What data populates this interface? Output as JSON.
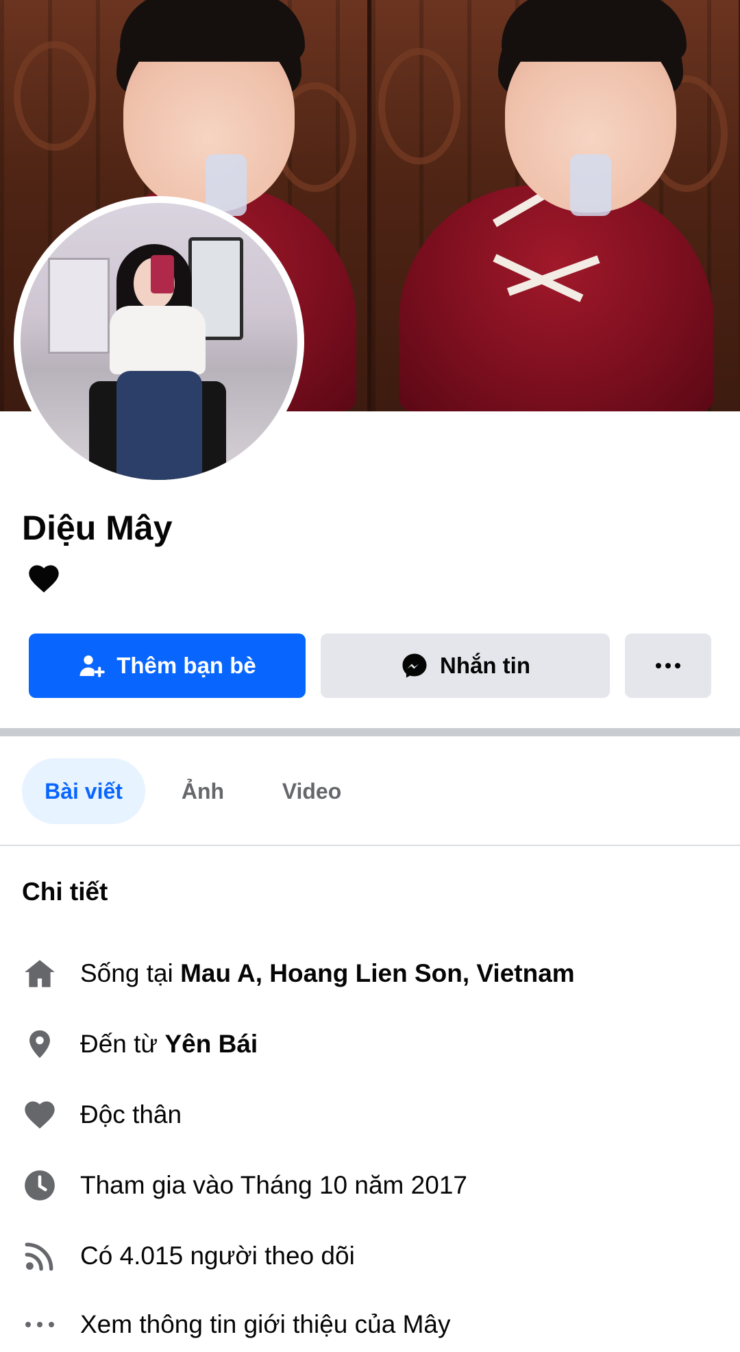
{
  "profile": {
    "name": "Diệu Mây",
    "bio_icon": "black-heart-icon"
  },
  "actions": {
    "add_friend_label": "Thêm bạn bè",
    "message_label": "Nhắn tin",
    "more_label": "···"
  },
  "tabs": [
    {
      "label": "Bài viết",
      "active": true
    },
    {
      "label": "Ảnh",
      "active": false
    },
    {
      "label": "Video",
      "active": false
    }
  ],
  "details": {
    "title": "Chi tiết",
    "items": [
      {
        "icon": "home-icon",
        "prefix": "Sống tại ",
        "bold": "Mau A, Hoang Lien Son, Vietnam"
      },
      {
        "icon": "location-pin-icon",
        "prefix": "Đến từ ",
        "bold": "Yên Bái"
      },
      {
        "icon": "heart-icon",
        "prefix": "Độc thân",
        "bold": ""
      },
      {
        "icon": "clock-icon",
        "prefix": "Tham gia vào Tháng 10 năm 2017",
        "bold": ""
      },
      {
        "icon": "rss-icon",
        "prefix": "Có 4.015 người theo dõi",
        "bold": ""
      },
      {
        "icon": "more-dots-icon",
        "prefix": "Xem thông tin giới thiệu của Mây",
        "bold": ""
      }
    ]
  },
  "colors": {
    "primary_blue": "#0866ff",
    "secondary_button": "#e4e6eb",
    "active_tab_bg": "#e7f3ff",
    "icon_gray": "#65676b"
  }
}
